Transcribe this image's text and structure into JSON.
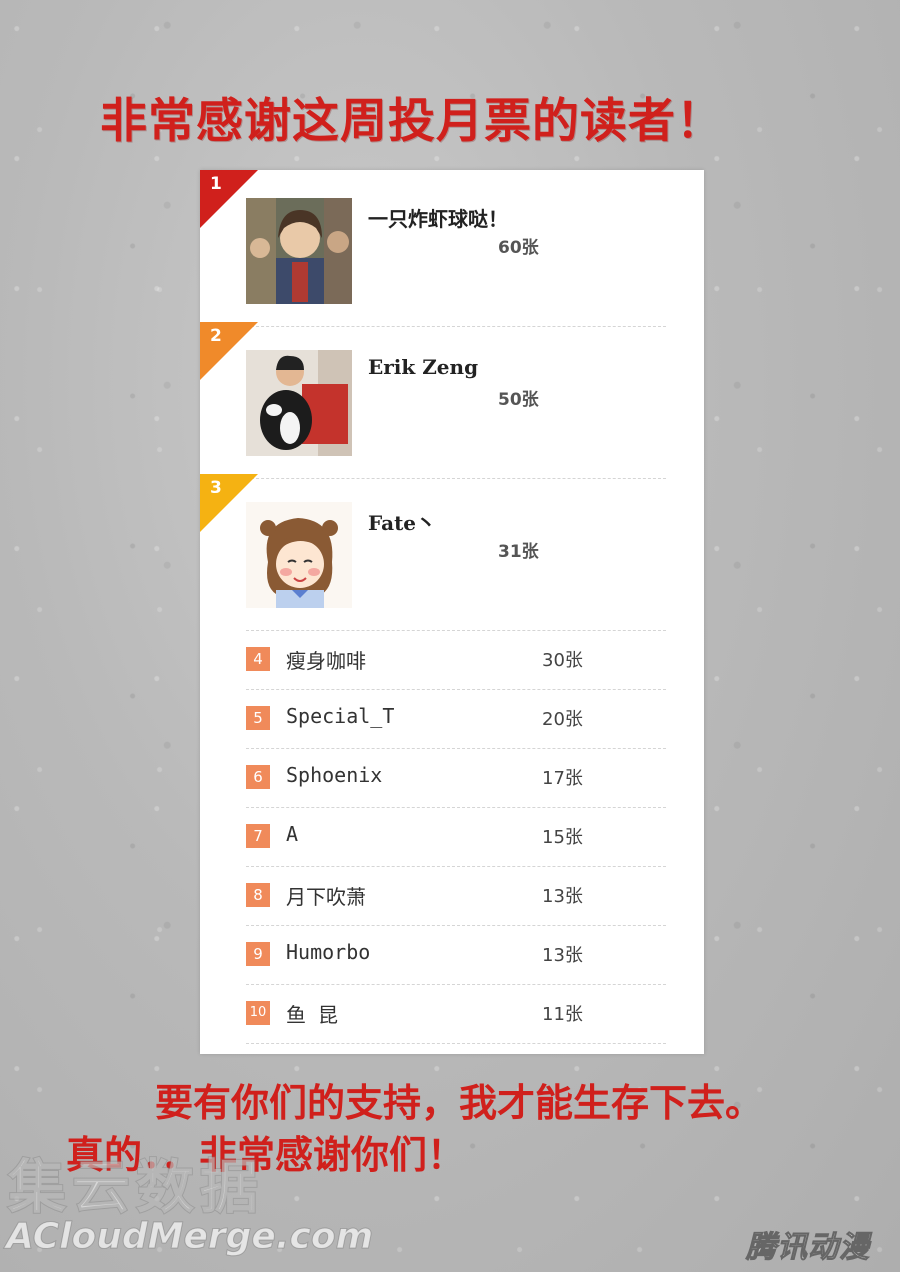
{
  "heading": "非常感谢这周投月票的读者！",
  "top_ranks": [
    {
      "rank": "1",
      "name": "一只炸虾球哒！",
      "count": "60张",
      "corner_color": "#d0201c"
    },
    {
      "rank": "2",
      "name": "Erik Zeng",
      "count": "50张",
      "corner_color": "#f08a2a"
    },
    {
      "rank": "3",
      "name": "Fate丶",
      "count": "31张",
      "corner_color": "#f5b212"
    }
  ],
  "ranks": [
    {
      "rank": "4",
      "name": "瘦身咖啡",
      "count": "30张"
    },
    {
      "rank": "5",
      "name": "Special_T",
      "count": "20张"
    },
    {
      "rank": "6",
      "name": "Sphoenix",
      "count": "17张"
    },
    {
      "rank": "7",
      "name": "A",
      "count": "15张"
    },
    {
      "rank": "8",
      "name": "月下吹萧",
      "count": "13张"
    },
    {
      "rank": "9",
      "name": "Humorbo",
      "count": "13张"
    },
    {
      "rank": "10",
      "name": "鱼 昆",
      "count": "11张"
    }
  ],
  "footer_line1": "要有你们的支持，我才能生存下去。",
  "footer_line2": "真的．．非常感谢你们！",
  "watermark_cn": "集云数据",
  "watermark_url": "ACloudMerge.com",
  "watermark_brand": "腾讯动漫"
}
